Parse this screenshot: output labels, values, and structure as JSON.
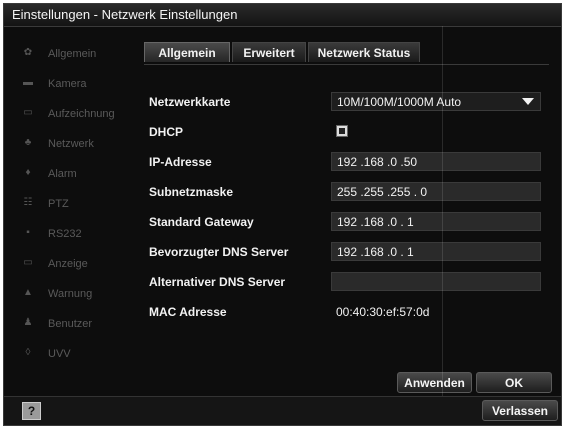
{
  "window": {
    "title": "Einstellungen - Netzwerk Einstellungen"
  },
  "sidebar": {
    "items": [
      {
        "label": "Allgemein",
        "icon": "gear-icon"
      },
      {
        "label": "Kamera",
        "icon": "camera-icon"
      },
      {
        "label": "Aufzeichnung",
        "icon": "record-icon"
      },
      {
        "label": "Netzwerk",
        "icon": "network-icon"
      },
      {
        "label": "Alarm",
        "icon": "alarm-icon"
      },
      {
        "label": "PTZ",
        "icon": "ptz-icon"
      },
      {
        "label": "RS232",
        "icon": "rs232-icon"
      },
      {
        "label": "Anzeige",
        "icon": "display-icon"
      },
      {
        "label": "Warnung",
        "icon": "warning-icon"
      },
      {
        "label": "Benutzer",
        "icon": "user-icon"
      },
      {
        "label": "UVV",
        "icon": "uvv-icon"
      }
    ]
  },
  "tabs": [
    "Allgemein",
    "Erweitert",
    "Netzwerk Status"
  ],
  "form": {
    "nic_label": "Netzwerkkarte",
    "nic_value": "10M/100M/1000M Auto",
    "dhcp_label": "DHCP",
    "ip_label": "IP-Adresse",
    "ip_value": "192 .168 .0     .50",
    "mask_label": "Subnetzmaske",
    "mask_value": "255 .255 .255 . 0",
    "gw_label": "Standard Gateway",
    "gw_value": "192 .168 .0     . 1",
    "dns1_label": "Bevorzugter DNS Server",
    "dns1_value": "192 .168 .0     . 1",
    "dns2_label": "Alternativer DNS Server",
    "dns2_value": "",
    "mac_label": "MAC Adresse",
    "mac_value": "00:40:30:ef:57:0d"
  },
  "buttons": {
    "apply": "Anwenden",
    "ok": "OK",
    "exit": "Verlassen",
    "help": "?"
  },
  "colors": {
    "background": "#0d0d0d",
    "field": "#2a2a2a",
    "text": "#f2f2f2",
    "sidebar_text": "#5a5a5a"
  }
}
